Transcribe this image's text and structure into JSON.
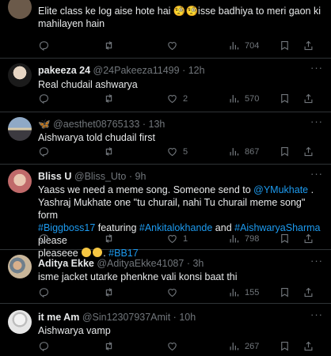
{
  "tweets": [
    {
      "name": "",
      "handle": "",
      "time": "",
      "text": "Elite class ke log aise hote hai 🧐🧐isse badhiya to meri gaon ki mahilayen hain",
      "replies": "",
      "retweets": "",
      "likes": "",
      "views": "704"
    },
    {
      "name": "pakeeza 24",
      "handle": "@24Pakeeza11499",
      "time": "12h",
      "text": "Real chudail ashwarya",
      "replies": "",
      "retweets": "",
      "likes": "2",
      "views": "570"
    },
    {
      "name": "🦋",
      "handle": "@aesthet08765133",
      "time": "13h",
      "text": "Aishwarya told chudail first",
      "replies": "",
      "retweets": "",
      "likes": "5",
      "views": "867"
    },
    {
      "name": "Bliss U",
      "handle": "@Bliss_Uto",
      "time": "9h",
      "text_parts": {
        "l1a": "Yaass we need a meme song. Someone send to ",
        "l1b": "@YMukhate",
        "l1c": " .",
        "l2": "Yashraj Mukhate one \"tu churail, nahi Tu churail meme song\" form",
        "l3a": "#Biggboss17",
        "l3b": " featuring ",
        "l3c": "#Ankitalokhande",
        "l3d": " and ",
        "l3e": "#AishwaryaSharma",
        "l3f": " please",
        "l4a": "pleaseee ",
        "l4b": ". ",
        "l4c": "#BB17"
      },
      "replies": "",
      "retweets": "",
      "likes": "1",
      "views": "798"
    },
    {
      "name": "Aditya Ekke",
      "handle": "@AdityaEkke41087",
      "time": "3h",
      "text": "isme jacket utarke phenkne vali konsi baat thi",
      "replies": "",
      "retweets": "",
      "likes": "",
      "views": "155"
    },
    {
      "name": "it me Am",
      "handle": "@Sin12307937Amit",
      "time": "10h",
      "text": "Aishwarya vamp",
      "replies": "",
      "retweets": "",
      "likes": "",
      "views": "267"
    }
  ],
  "sep": "·",
  "colors": {
    "link": "#1d9bf0",
    "muted": "#71767b",
    "text": "#e7e9ea",
    "border": "#2f3336"
  },
  "icons": [
    "reply-icon",
    "retweet-icon",
    "like-icon",
    "views-icon",
    "bookmark-icon",
    "share-icon",
    "more-icon"
  ]
}
